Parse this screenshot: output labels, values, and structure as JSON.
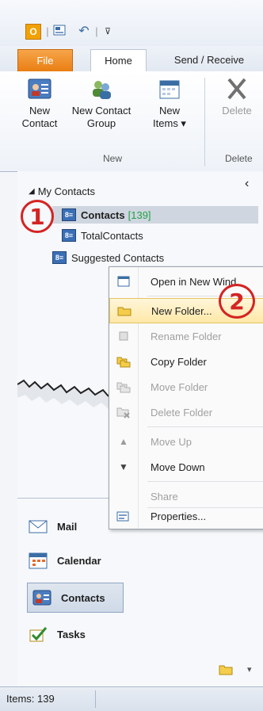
{
  "qat": {
    "undo_glyph": "↶",
    "more_glyph": "⊽"
  },
  "tabs": {
    "file": "File",
    "home": "Home",
    "send_receive": "Send / Receive"
  },
  "ribbon": {
    "new_contact": [
      "New",
      "Contact"
    ],
    "new_contact_group": [
      "New Contact",
      "Group"
    ],
    "new_items": [
      "New",
      "Items ▾"
    ],
    "delete": [
      "Delete",
      ""
    ],
    "group_new": "New",
    "group_delete": "Delete"
  },
  "nav": {
    "root": "My Contacts",
    "items": [
      {
        "label": "Contacts",
        "count": "[139]"
      },
      {
        "label": "TotalContacts"
      },
      {
        "label": "Suggested Contacts"
      }
    ],
    "collapse_glyph": "‹"
  },
  "context_menu": {
    "items": [
      {
        "label": "Open in New Wind",
        "disabled": false,
        "icon": "open-window-icon"
      },
      {
        "label": "New Folder...",
        "disabled": false,
        "icon": "new-folder-icon"
      },
      {
        "label": "Rename Folder",
        "disabled": true,
        "icon": "rename-folder-icon"
      },
      {
        "label": "Copy Folder",
        "disabled": false,
        "icon": "copy-folder-icon"
      },
      {
        "label": "Move Folder",
        "disabled": true,
        "icon": "move-folder-icon"
      },
      {
        "label": "Delete Folder",
        "disabled": true,
        "icon": "delete-folder-icon"
      },
      {
        "label": "Move Up",
        "disabled": true,
        "icon": "arrow-up-icon"
      },
      {
        "label": "Move Down",
        "disabled": false,
        "icon": "arrow-down-icon"
      },
      {
        "label": "Share",
        "disabled": true,
        "icon": ""
      },
      {
        "label": "Properties...",
        "disabled": false,
        "icon": "properties-icon"
      }
    ]
  },
  "annotations": {
    "step1": "1",
    "step2": "2"
  },
  "bottom_nav": {
    "mail": "Mail",
    "calendar": "Calendar",
    "contacts": "Contacts",
    "tasks": "Tasks"
  },
  "status": {
    "items": "Items: 139"
  },
  "colors": {
    "file_tab": "#e97e12",
    "count_green": "#22a045",
    "annotation_red": "#d42323",
    "highlight": "#ffe8a8"
  }
}
